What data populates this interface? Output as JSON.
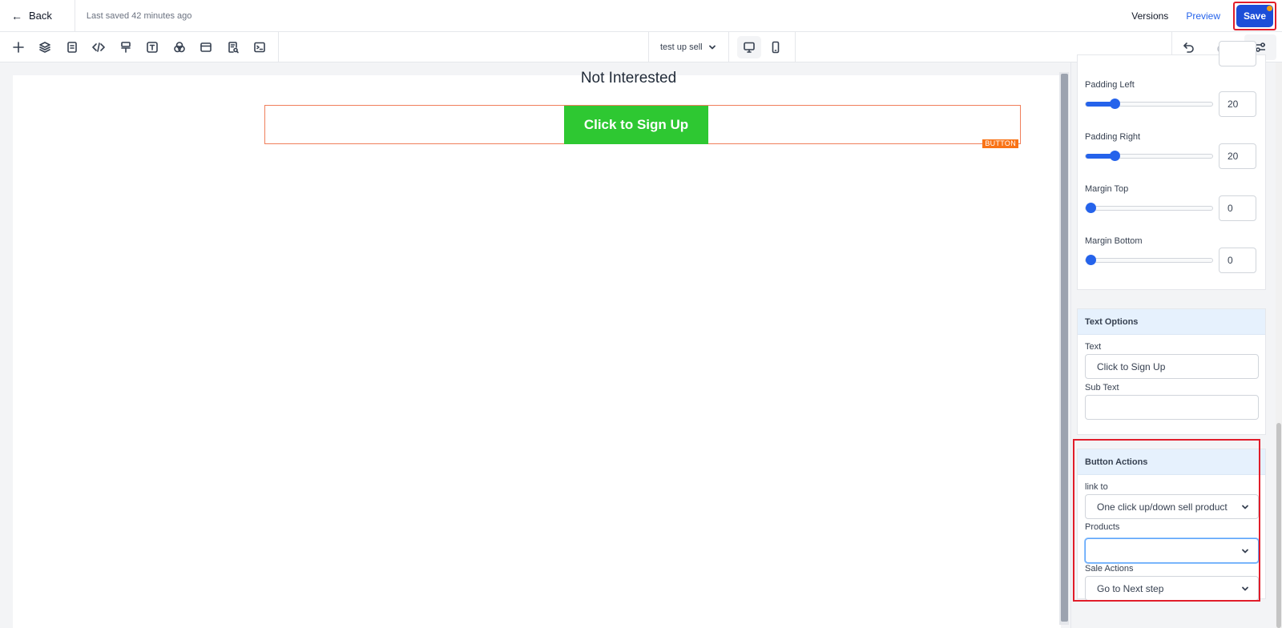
{
  "header": {
    "back_label": "Back",
    "last_saved": "Last saved 42 minutes ago",
    "versions_label": "Versions",
    "preview_label": "Preview",
    "save_label": "Save"
  },
  "toolbar": {
    "tools": [
      "plus-icon",
      "layers-icon",
      "page-icon",
      "code-icon",
      "paint-roller-icon",
      "text-icon",
      "color-circles-icon",
      "layout-icon",
      "search-document-icon",
      "terminal-icon"
    ],
    "page_name": "test up sell"
  },
  "canvas": {
    "cta_label": "Click to Sign Up",
    "element_tag": "BUTTON",
    "secondary_link": "Not Interested"
  },
  "panel": {
    "spacing": {
      "padding_left": {
        "label": "Padding Left",
        "value": "20"
      },
      "padding_right": {
        "label": "Padding Right",
        "value": "20"
      },
      "margin_top": {
        "label": "Margin Top",
        "value": "0"
      },
      "margin_bottom": {
        "label": "Margin Bottom",
        "value": "0"
      }
    },
    "text_options": {
      "title": "Text Options",
      "text_label": "Text",
      "text_value": "Click to Sign Up",
      "subtext_label": "Sub Text",
      "subtext_value": ""
    },
    "button_actions": {
      "title": "Button Actions",
      "link_label": "link to",
      "link_value": "One click up/down sell product",
      "products_label": "Products",
      "products_value": "",
      "sale_label": "Sale Actions",
      "sale_value": "Go to Next step"
    }
  },
  "colors": {
    "accent": "#2563eb",
    "save_button": "#1d4ed8",
    "cta_green": "#2ec832",
    "selection_outline": "#f07f5b",
    "highlight_red": "#e11d2a"
  }
}
